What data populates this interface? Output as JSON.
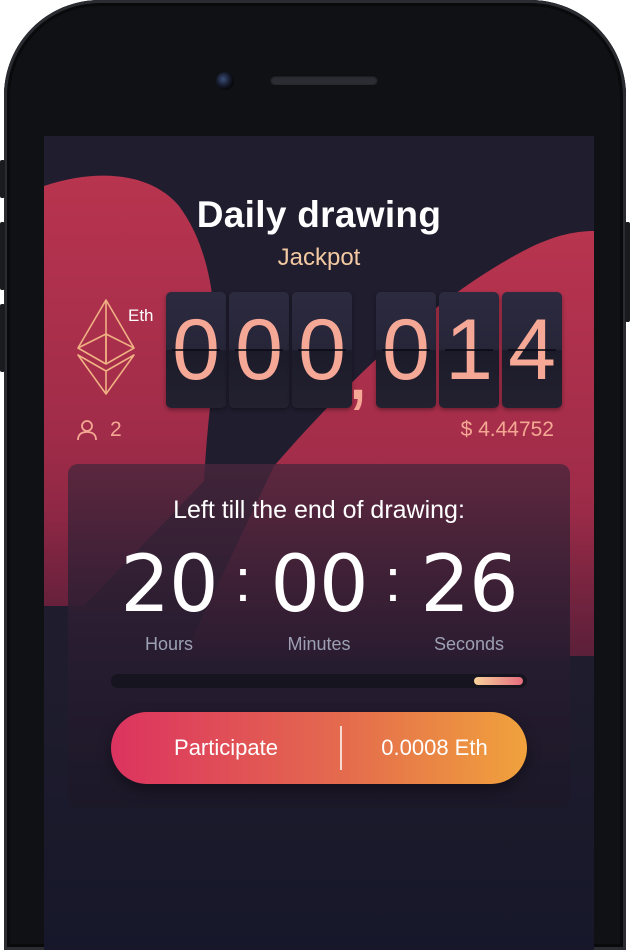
{
  "header": {
    "title": "Daily drawing",
    "subtitle": "Jackpot"
  },
  "jackpot": {
    "currency": "Eth",
    "digits_left": [
      "0",
      "0",
      "0"
    ],
    "separator": ",",
    "digits_right": [
      "0",
      "1",
      "4"
    ],
    "participants": "2",
    "usd_value": "$ 4.44752"
  },
  "countdown": {
    "title": "Left till the end of drawing:",
    "hours": "20",
    "minutes": "00",
    "seconds": "26",
    "separator": ":",
    "labels": {
      "hours": "Hours",
      "minutes": "Minutes",
      "seconds": "Seconds"
    },
    "progress_start": 0.88,
    "progress_end": 1.0
  },
  "cta": {
    "label": "Participate",
    "price": "0.0008 Eth"
  },
  "colors": {
    "accent_start": "#dc3360",
    "accent_end": "#f0a23c",
    "digit_text": "#f6a896",
    "subtitle": "#f2c9a2",
    "background": "#1e1c2b"
  },
  "icons": {
    "currency": "ethereum-icon",
    "participants": "user-icon"
  }
}
